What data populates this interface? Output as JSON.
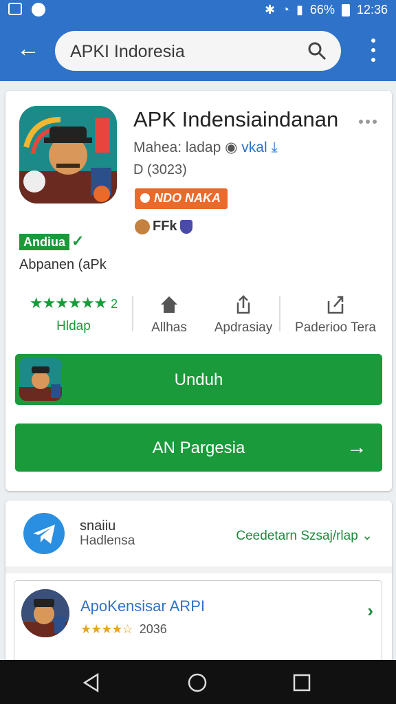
{
  "status_bar": {
    "battery": "66%",
    "time": "12:36"
  },
  "search": {
    "query": "APKI Indoresia"
  },
  "app": {
    "title": "APK Indensiaindanan",
    "developer": "Mahea: ladap",
    "developer_link": "vkal",
    "date": "D (3023)",
    "tag_badge": "NDO NAKA",
    "mini_label": "FFk",
    "category_badge": "Andiua",
    "category_check": "✓",
    "category_text": "Abpanen (aPk",
    "rating_stars": "★★★★★★",
    "rating_count": "2",
    "rating_label": "Hldap",
    "stat2_label": "Allhas",
    "stat3_label": "Apdrasiay",
    "stat4_label": "Paderioo Tera",
    "install_label": "Unduh",
    "secondary_label": "AN Pargesia",
    "secondary_arrow": "→"
  },
  "related": {
    "publisher_name": "snaiiu",
    "publisher_sub": "Hadlensa",
    "see_all": "Ceedetarn Szsaj/rlap ⌄",
    "item_title": "ApoKensisar ARPI",
    "item_stars": "★★★★☆",
    "item_count": "2036",
    "item_chevron": "›",
    "below_text": "..."
  },
  "colors": {
    "brand_blue": "#2f72c9",
    "green": "#1a9a3a",
    "orange": "#ea6a2c"
  },
  "icons": [
    "back-arrow-icon",
    "search-icon",
    "more-vert-icon",
    "home-icon",
    "share-icon",
    "share-box-icon",
    "telegram-icon",
    "back-nav-icon",
    "home-nav-icon",
    "recents-nav-icon"
  ]
}
